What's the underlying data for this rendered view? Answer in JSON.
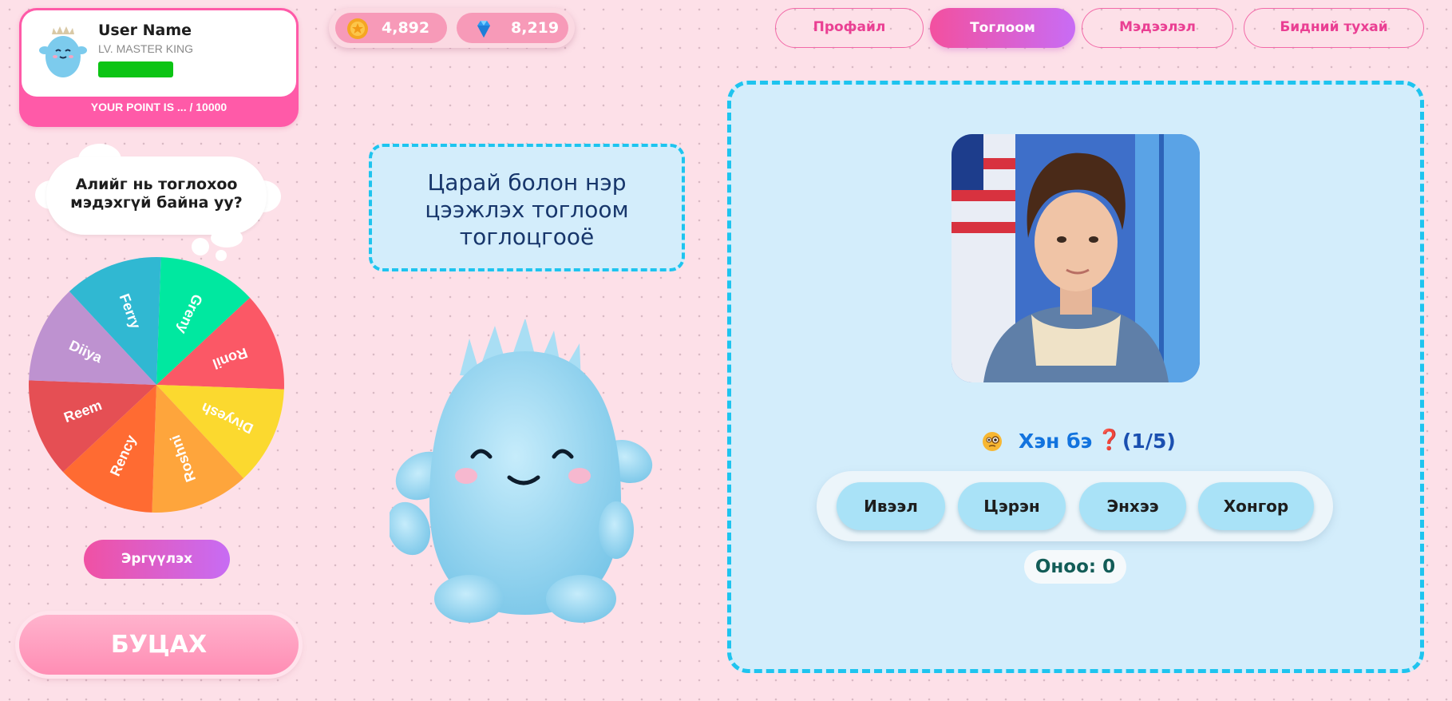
{
  "profile": {
    "user_name": "User Name",
    "level": "LV. MASTER KING",
    "points_text": "YOUR POINT IS ... / 10000",
    "level_bar_color": "#0cc414"
  },
  "currency": {
    "coins": "4,892",
    "gems": "8,219"
  },
  "nav": {
    "items": [
      {
        "label": "Профайл",
        "active": false
      },
      {
        "label": "Тоглоом",
        "active": true
      },
      {
        "label": "Мэдээлэл",
        "active": false
      },
      {
        "label": "Бидний тухай",
        "active": false
      }
    ]
  },
  "bubble": {
    "line1": "Алийг нь тоглохоо",
    "line2": "мэдэхгүй байна уу?"
  },
  "wheel": {
    "segments": [
      {
        "label": "Greny",
        "color": "#00e8a0"
      },
      {
        "label": "Ronil",
        "color": "#fb5866"
      },
      {
        "label": "Divyesh",
        "color": "#fbd92f"
      },
      {
        "label": "Roshni",
        "color": "#fea53c"
      },
      {
        "label": "Rency",
        "color": "#ff6b32"
      },
      {
        "label": "Reem",
        "color": "#e54f54"
      },
      {
        "label": "Diiya",
        "color": "#be92d0"
      },
      {
        "label": "Ferry",
        "color": "#30b8d2"
      }
    ],
    "spin_label": "Эргүүлэх"
  },
  "back_label": "БУЦАХ",
  "title": {
    "line1": "Царай болон нэр",
    "line2": "цээжлэх тоглоом",
    "line3": "тоглоцгооё"
  },
  "game": {
    "question_emoji": "face-with-monocle-icon",
    "question": "Хэн бэ",
    "question_mark": "❓",
    "progress": "(1/5)",
    "answers": [
      "Ивээл",
      "Цэрэн",
      "Энхээ",
      "Хонгор"
    ],
    "score": "Оноо: 0"
  },
  "colors": {
    "accent_pink": "#ff5aa8",
    "accent_purple": "#c86cf5",
    "panel_border": "#1ec4ef",
    "panel_bg": "#d3edfb"
  }
}
